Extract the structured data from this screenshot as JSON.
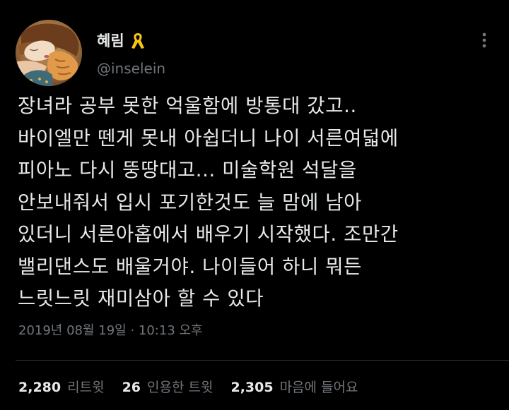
{
  "author": {
    "display_name": "혜림",
    "handle": "@inselein",
    "ribbon_icon": "yellow-ribbon-icon",
    "ribbon_color": "#f5c518",
    "more_icon": "more-dots-icon"
  },
  "tweet": {
    "lines": [
      "장녀라 공부 못한 억울함에 방통대 갔고..",
      "바이엘만 뗀게 못내 아쉽더니 나이 서른여덟에",
      "피아노 다시 뚱땅대고... 미술학원 석달을",
      "안보내줘서 입시 포기한것도 늘 맘에 남아",
      "있더니 서른아홉에서 배우기 시작했다. 조만간",
      "밸리댄스도 배울거야. 나이들어 하니 뭐든",
      "느릿느릿 재미삼아 할 수 있다"
    ],
    "timestamp": "2019년 08월 19일 · 10:13 오후"
  },
  "stats": {
    "retweets_count": "2,280",
    "retweets_label": "리트윗",
    "quotes_count": "26",
    "quotes_label": "인용한 트윗",
    "likes_count": "2,305",
    "likes_label": "마음에 들어요"
  },
  "colors": {
    "background": "#000000",
    "text_primary": "#e7e9ea",
    "text_secondary": "#71767b",
    "divider": "#2f3336"
  }
}
